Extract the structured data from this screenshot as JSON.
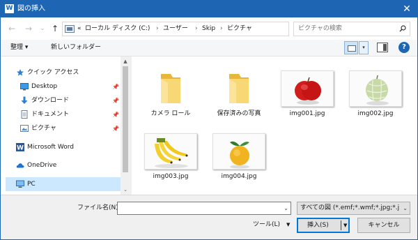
{
  "window": {
    "app_icon": "W",
    "title": "図の挿入",
    "close_glyph": "✕"
  },
  "nav": {
    "back_glyph": "←",
    "forward_glyph": "→",
    "recent_glyph": "⌄",
    "up_glyph": "↑"
  },
  "address": {
    "prefix": "«",
    "crumbs": [
      "ローカル ディスク (C:)",
      "ユーザー",
      "Skip",
      "ピクチャ"
    ],
    "sep": "›",
    "dropdown_glyph": "⌄",
    "refresh_glyph": "↻"
  },
  "search": {
    "placeholder": "ピクチャの検索"
  },
  "toolbar": {
    "organize": "整理 ▾",
    "new_folder": "新しいフォルダー",
    "view_drop": "▾",
    "help": "?"
  },
  "sidebar": {
    "items": [
      {
        "label": "クイック アクセス",
        "icon": "star-icon"
      },
      {
        "label": "Desktop",
        "icon": "desktop-icon",
        "pinned": true
      },
      {
        "label": "ダウンロード",
        "icon": "download-icon",
        "pinned": true
      },
      {
        "label": "ドキュメント",
        "icon": "document-icon",
        "pinned": true
      },
      {
        "label": "ピクチャ",
        "icon": "pictures-icon",
        "pinned": true
      },
      {
        "label": "Microsoft Word",
        "icon": "word-icon"
      },
      {
        "label": "OneDrive",
        "icon": "cloud-icon"
      },
      {
        "label": "PC",
        "icon": "pc-icon",
        "selected": true
      }
    ],
    "pin_glyph": "📌",
    "scroll_up": "▲",
    "scroll_down": "⌄"
  },
  "files": [
    {
      "name": "カメラ ロール",
      "kind": "folder"
    },
    {
      "name": "保存済みの写真",
      "kind": "folder"
    },
    {
      "name": "img001.jpg",
      "kind": "image",
      "subject": "red-apple"
    },
    {
      "name": "img002.jpg",
      "kind": "image",
      "subject": "melon"
    },
    {
      "name": "img003.jpg",
      "kind": "image",
      "subject": "bananas"
    },
    {
      "name": "img004.jpg",
      "kind": "image",
      "subject": "citrus"
    }
  ],
  "bottom": {
    "filename_label": "ファイル名(N):",
    "filename_value": "",
    "filter": "すべての図 (*.emf;*.wmf;*.jpg;*.jp",
    "tools": "ツール(L)",
    "tools_chev": "▼",
    "insert": "挿入(S)",
    "insert_chev": "▼",
    "cancel": "キャンセル",
    "dropdown_glyph": "⌄"
  },
  "colors": {
    "title_bar": "#1e65b4",
    "selection": "#cce8ff",
    "folder": "#f8d775",
    "accent": "#0078d7"
  }
}
